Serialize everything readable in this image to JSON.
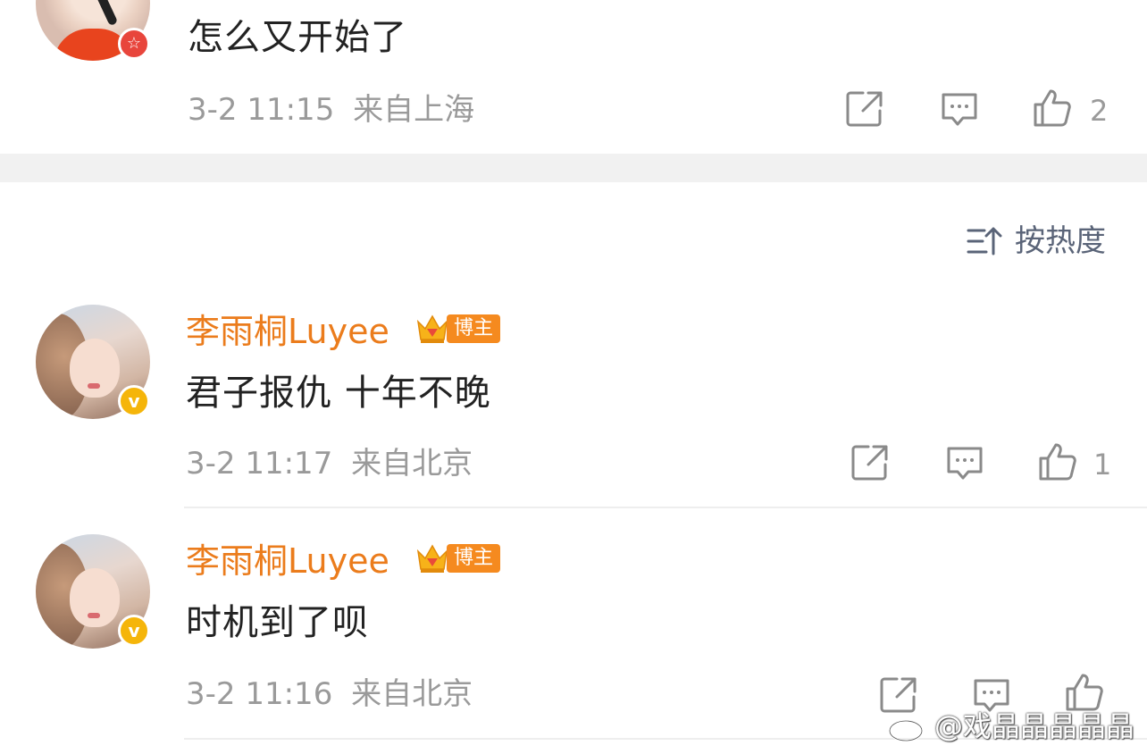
{
  "top_comment": {
    "text": "怎么又开始了",
    "time": "3-2 11:15",
    "location": "来自上海",
    "like_count": "2",
    "badge_icon": "star-icon"
  },
  "sort": {
    "label": "按热度",
    "icon": "sort-icon"
  },
  "comments": [
    {
      "username": "李雨桐Luyee",
      "tag": "博主",
      "text": "君子报仇 十年不晚",
      "time": "3-2 11:17",
      "location": "来自北京",
      "like_count": "1"
    },
    {
      "username": "李雨桐Luyee",
      "tag": "博主",
      "text": "时机到了呗",
      "time": "3-2 11:16",
      "location": "来自北京",
      "like_count": ""
    }
  ],
  "watermark": "@戏晶晶晶晶晶",
  "colors": {
    "username": "#eb7c1c",
    "meta": "#9a9a9a",
    "tag": "#f58a1f",
    "verified": "#f5b50a",
    "separator": "#f1f1f1"
  }
}
